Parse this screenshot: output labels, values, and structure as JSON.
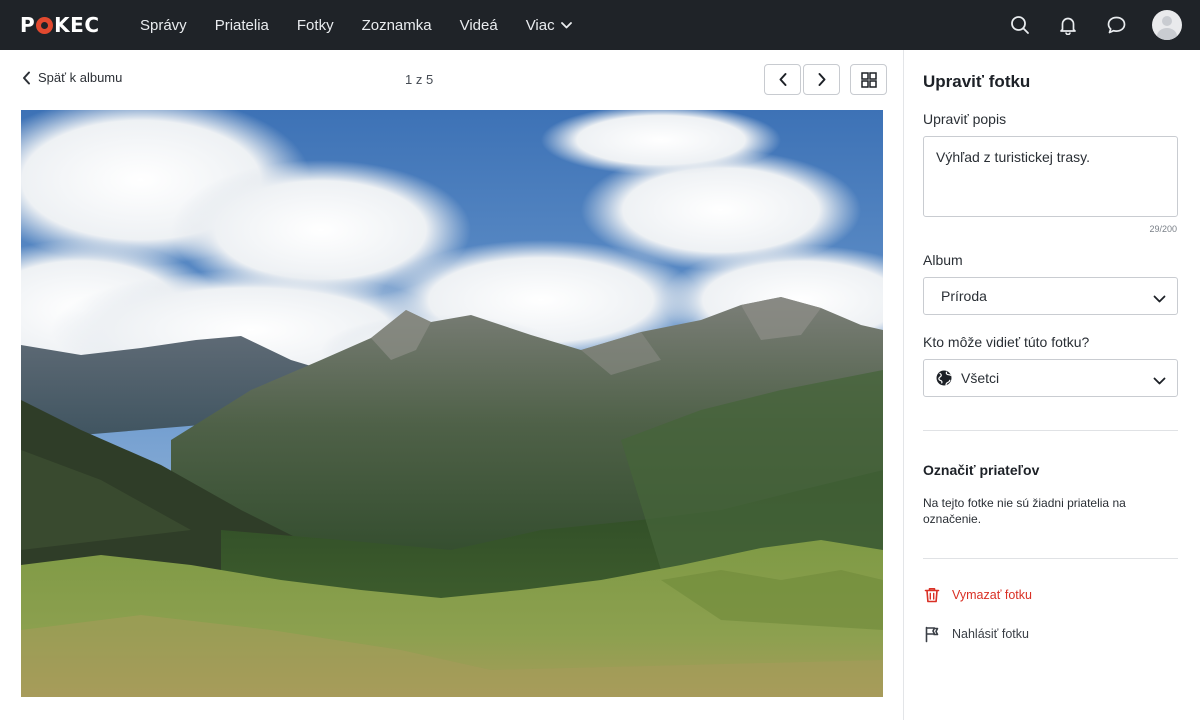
{
  "app": {
    "logo_text": "POKEC",
    "brand_color": "#e2492f",
    "topbar_color": "#1f2328"
  },
  "nav": {
    "items": [
      {
        "label": "Správy"
      },
      {
        "label": "Priatelia"
      },
      {
        "label": "Fotky"
      },
      {
        "label": "Zoznamka"
      },
      {
        "label": "Videá"
      },
      {
        "label": "Viac"
      }
    ]
  },
  "top_icons": [
    "search-icon",
    "bell-icon",
    "chat-bubble-icon",
    "avatar"
  ],
  "viewer": {
    "back_label": "Späť k albumu",
    "counter": "1 z 5",
    "photo_subject": "mountain-landscape-photo"
  },
  "editor": {
    "title": "Upraviť fotku",
    "description_label": "Upraviť popis",
    "description_value": "Výhľad z turistickej trasy.",
    "char_count": "29/200",
    "album_label": "Album",
    "album_value": "Príroda",
    "visibility_label": "Kto môže vidieť túto fotku?",
    "visibility_value": "Všetci",
    "tag_title": "Označiť priateľov",
    "tag_note": "Na tejto fotke nie sú žiadni priatelia na označenie.",
    "delete_label": "Vymazať fotku",
    "report_label": "Nahlásiť fotku",
    "danger_color": "#d93025"
  }
}
